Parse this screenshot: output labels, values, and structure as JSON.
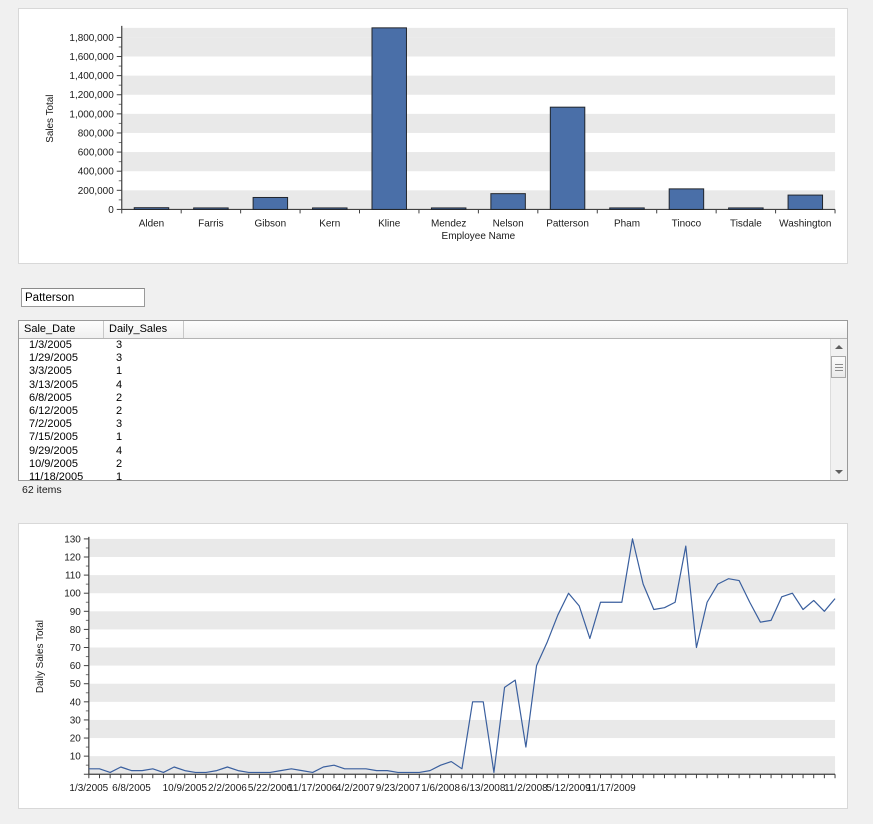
{
  "colors": {
    "bar_fill": "#4a6fa8",
    "bar_stroke": "#21252b",
    "line_stroke": "#3a5f9e",
    "band": "#e9e9e9",
    "page_bg": "#f0f0f0",
    "panel_bg": "#ffffff"
  },
  "name_filter": {
    "value": "Patterson",
    "placeholder": ""
  },
  "grid": {
    "columns": [
      "Sale_Date",
      "Daily_Sales",
      ""
    ],
    "rows": [
      [
        "1/3/2005",
        "3"
      ],
      [
        "1/29/2005",
        "3"
      ],
      [
        "3/3/2005",
        "1"
      ],
      [
        "3/13/2005",
        "4"
      ],
      [
        "6/8/2005",
        "2"
      ],
      [
        "6/12/2005",
        "2"
      ],
      [
        "7/2/2005",
        "3"
      ],
      [
        "7/15/2005",
        "1"
      ],
      [
        "9/29/2005",
        "4"
      ],
      [
        "10/9/2005",
        "2"
      ],
      [
        "11/18/2005",
        "1"
      ]
    ],
    "status": "62 items",
    "scrollbar": {
      "up_arrow": "scroll-up-arrow",
      "down_arrow": "scroll-down-arrow"
    }
  },
  "chart_data": [
    {
      "type": "bar",
      "id": "sales-by-employee",
      "title": "",
      "xlabel": "Employee Name",
      "ylabel": "Sales Total",
      "ylim": [
        0,
        1900000
      ],
      "ytick_step": 200000,
      "yticks": [
        0,
        200000,
        400000,
        600000,
        800000,
        1000000,
        1200000,
        1400000,
        1600000,
        1800000
      ],
      "ytick_labels": [
        "0",
        "200,000",
        "400,000",
        "600,000",
        "800,000",
        "1,000,000",
        "1,200,000",
        "1,400,000",
        "1,600,000",
        "1,800,000"
      ],
      "grid": true,
      "legend": "none",
      "categories": [
        "Alden",
        "Farris",
        "Gibson",
        "Kern",
        "Kline",
        "Mendez",
        "Nelson",
        "Patterson",
        "Pham",
        "Tinoco",
        "Tisdale",
        "Washington"
      ],
      "values": [
        18000,
        4000,
        125000,
        4000,
        1900000,
        4000,
        165000,
        1070000,
        4000,
        215000,
        4000,
        150000
      ]
    },
    {
      "type": "line",
      "id": "daily-sales-over-time",
      "title": "",
      "xlabel": "",
      "ylabel": "Daily Sales Total",
      "ylim": [
        0,
        130
      ],
      "ytick_step": 10,
      "yticks": [
        0,
        10,
        20,
        30,
        40,
        50,
        60,
        70,
        80,
        90,
        100,
        110,
        120,
        130
      ],
      "ytick_labels": [
        "",
        "10",
        "20",
        "30",
        "40",
        "50",
        "60",
        "70",
        "80",
        "90",
        "100",
        "110",
        "120",
        "130"
      ],
      "grid": true,
      "legend": "none",
      "xtick_labels": [
        "1/3/2005",
        "6/8/2005",
        "10/9/2005",
        "2/2/2006",
        "5/22/2006",
        "11/17/2006",
        "4/2/2007",
        "9/23/2007",
        "1/6/2008",
        "6/13/2008",
        "11/2/2008",
        "5/12/2009",
        "11/17/2009"
      ],
      "xtick_indices": [
        0,
        4,
        9,
        13,
        17,
        21,
        25,
        29,
        33,
        37,
        41,
        45,
        49
      ],
      "values": [
        3,
        3,
        1,
        4,
        2,
        2,
        3,
        1,
        4,
        2,
        1,
        1,
        2,
        4,
        2,
        1,
        1,
        1,
        2,
        3,
        2,
        1,
        4,
        5,
        3,
        3,
        3,
        2,
        2,
        1,
        1,
        1,
        2,
        5,
        7,
        3,
        40,
        40,
        1,
        48,
        52,
        15,
        60,
        73,
        88,
        100,
        93,
        75,
        95,
        95,
        95,
        130,
        105,
        91,
        92,
        95,
        126,
        70,
        95,
        105,
        108,
        107,
        95,
        84,
        85,
        98,
        100,
        91,
        96,
        90,
        97
      ]
    }
  ]
}
